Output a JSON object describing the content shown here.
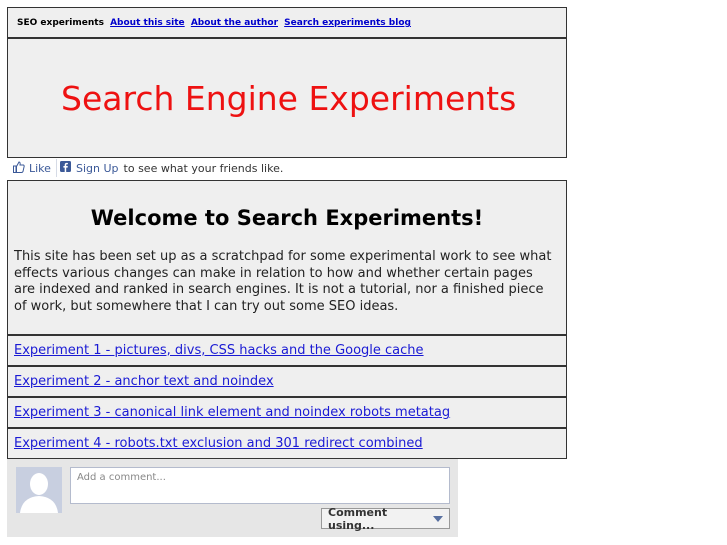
{
  "nav": {
    "site_label": "SEO experiments",
    "links": [
      "About this site",
      "About the author",
      "Search experiments blog"
    ]
  },
  "header": {
    "title": "Search Engine Experiments"
  },
  "facebook": {
    "like_label": "Like",
    "signup_label": "Sign Up",
    "signup_suffix": "to see what your friends like."
  },
  "welcome": {
    "heading": "Welcome to Search Experiments!",
    "body": "This site has been set up as a scratchpad for some experimental work to see what effects various changes can make in relation to how and whether certain pages are indexed and ranked in search engines. It is not a tutorial, nor a finished piece of work, but somewhere that I can try out some SEO ideas."
  },
  "experiments": [
    "Experiment 1 - pictures, divs, CSS hacks and the Google cache",
    "Experiment 2 - anchor text and noindex",
    "Experiment 3 - canonical link element and noindex robots metatag",
    "Experiment 4 - robots.txt exclusion and 301 redirect combined"
  ],
  "comments": {
    "placeholder": "Add a comment...",
    "button_label": "Comment using..."
  },
  "colors": {
    "title": "#ee1111",
    "link": "#1a1ad4",
    "facebook": "#3b5998",
    "panel_bg": "#efefef"
  }
}
